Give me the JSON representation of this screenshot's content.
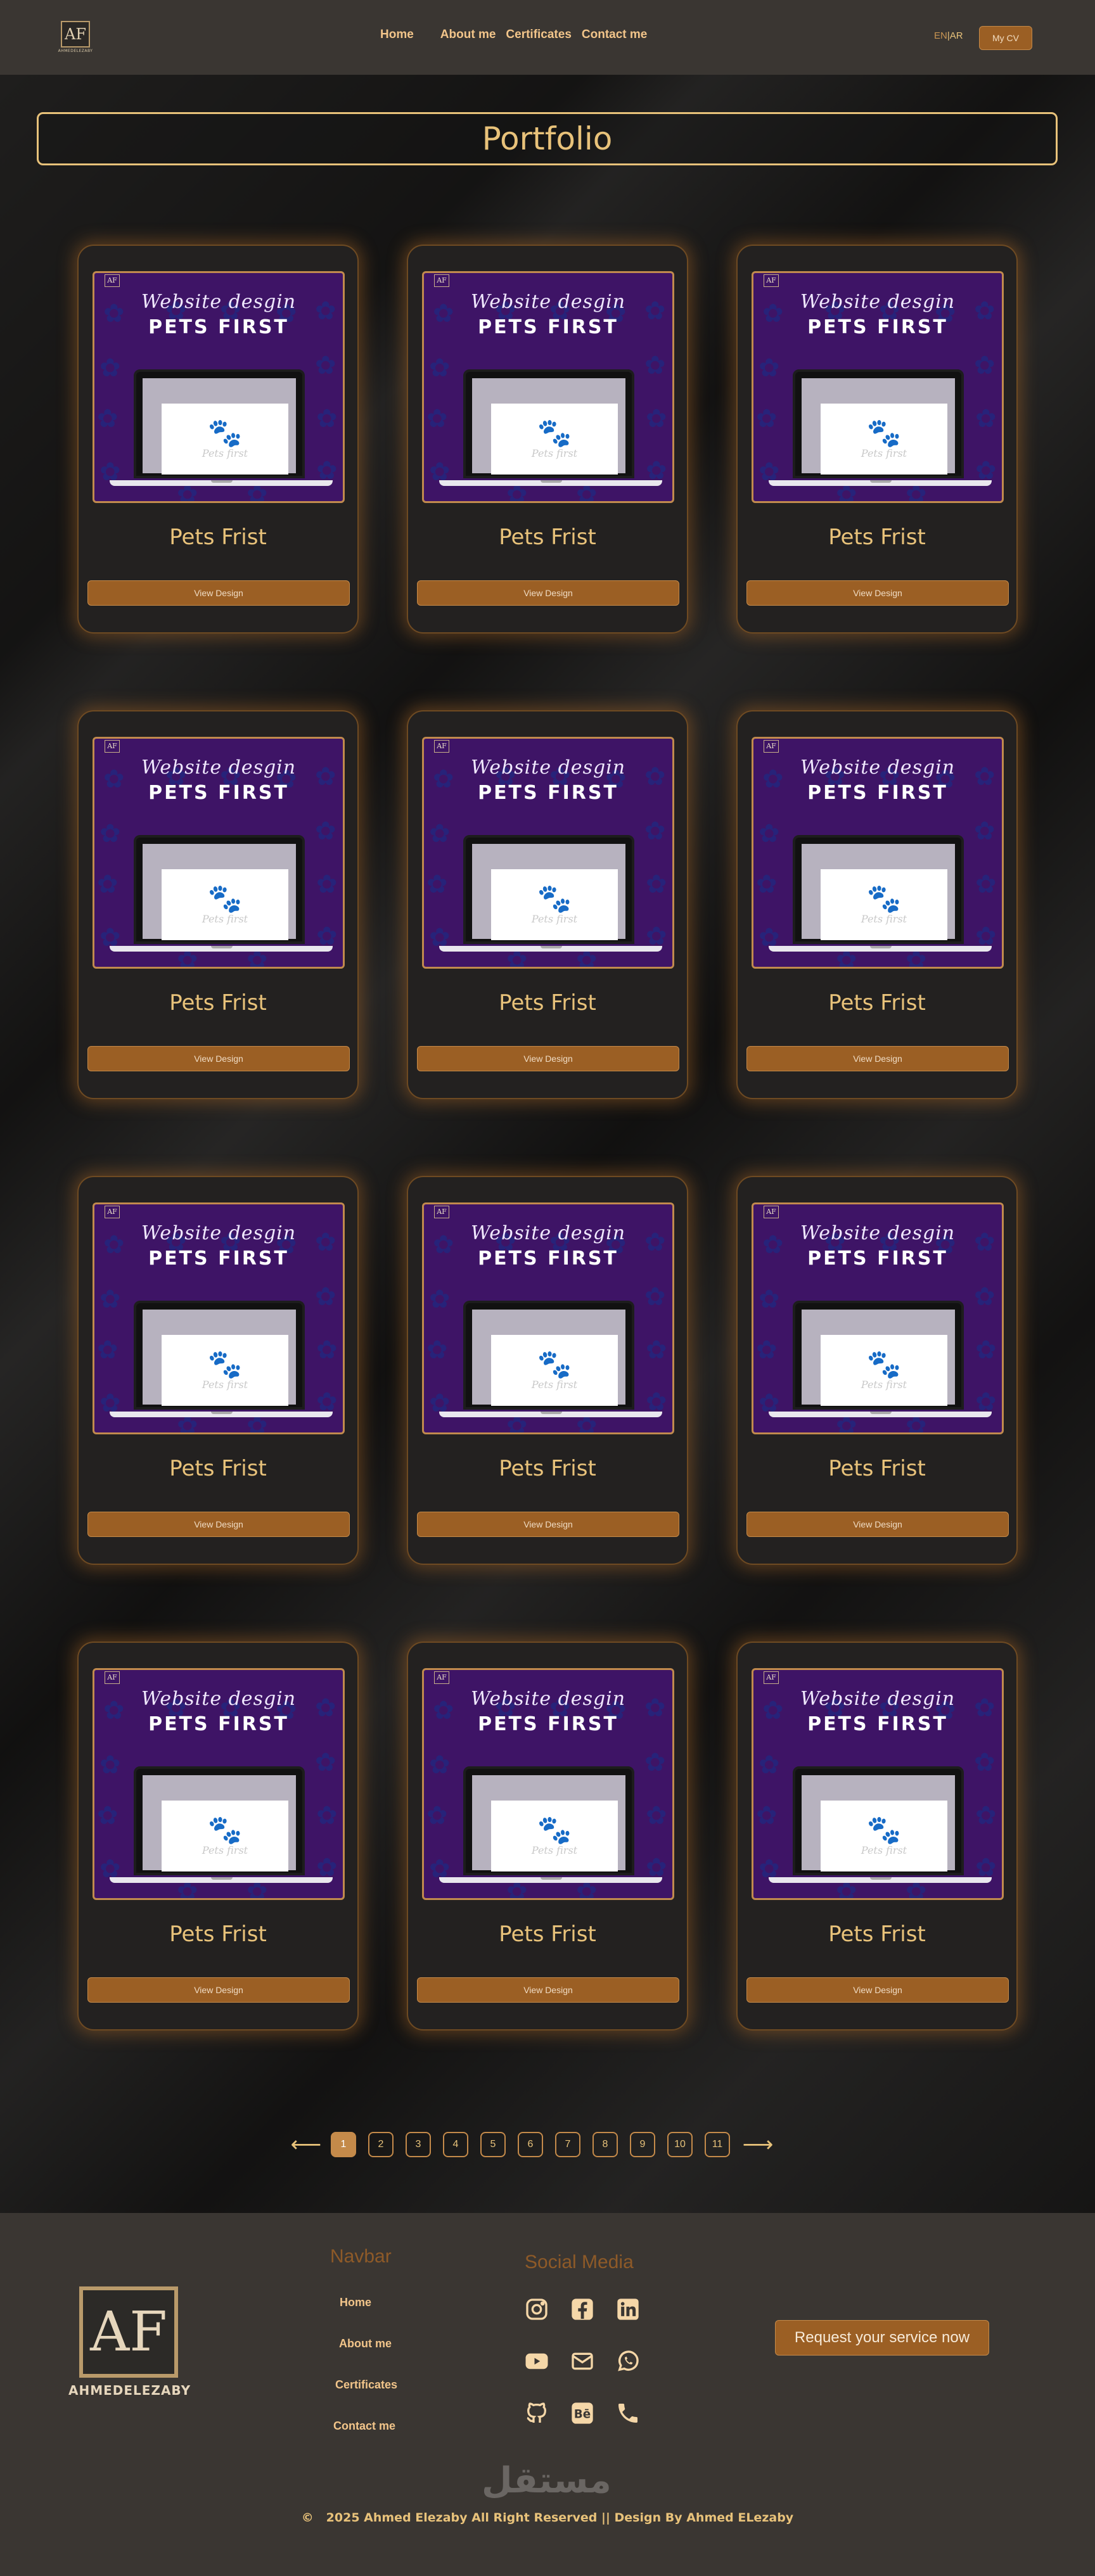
{
  "header": {
    "logo_caption": "AHMEDELEZABY",
    "logo_mark": "AF",
    "nav": [
      "Home",
      "About me",
      "Certificates",
      "Contact me"
    ],
    "lang_en": "EN",
    "lang_sep": "|",
    "lang_ar": "AR",
    "cv_label": "My CV"
  },
  "page_title": "Portfolio",
  "cards": [
    {
      "script": "Website desgin",
      "heading": "PETS FIRST",
      "screen_text": "Pets first",
      "title": "Pets Frist",
      "button": "View Design"
    },
    {
      "script": "Website desgin",
      "heading": "PETS FIRST",
      "screen_text": "Pets first",
      "title": "Pets Frist",
      "button": "View Design"
    },
    {
      "script": "Website desgin",
      "heading": "PETS FIRST",
      "screen_text": "Pets first",
      "title": "Pets Frist",
      "button": "View Design"
    },
    {
      "script": "Website desgin",
      "heading": "PETS FIRST",
      "screen_text": "Pets first",
      "title": "Pets Frist",
      "button": "View Design"
    },
    {
      "script": "Website desgin",
      "heading": "PETS FIRST",
      "screen_text": "Pets first",
      "title": "Pets Frist",
      "button": "View Design"
    },
    {
      "script": "Website desgin",
      "heading": "PETS FIRST",
      "screen_text": "Pets first",
      "title": "Pets Frist",
      "button": "View Design"
    },
    {
      "script": "Website desgin",
      "heading": "PETS FIRST",
      "screen_text": "Pets first",
      "title": "Pets Frist",
      "button": "View Design"
    },
    {
      "script": "Website desgin",
      "heading": "PETS FIRST",
      "screen_text": "Pets first",
      "title": "Pets Frist",
      "button": "View Design"
    },
    {
      "script": "Website desgin",
      "heading": "PETS FIRST",
      "screen_text": "Pets first",
      "title": "Pets Frist",
      "button": "View Design"
    },
    {
      "script": "Website desgin",
      "heading": "PETS FIRST",
      "screen_text": "Pets first",
      "title": "Pets Frist",
      "button": "View Design"
    },
    {
      "script": "Website desgin",
      "heading": "PETS FIRST",
      "screen_text": "Pets first",
      "title": "Pets Frist",
      "button": "View Design"
    },
    {
      "script": "Website desgin",
      "heading": "PETS FIRST",
      "screen_text": "Pets first",
      "title": "Pets Frist",
      "button": "View Design"
    }
  ],
  "pagination": {
    "prev_icon": "arrow-left-icon",
    "next_icon": "arrow-right-icon",
    "pages": [
      "1",
      "2",
      "3",
      "4",
      "5",
      "6",
      "7",
      "8",
      "9",
      "10",
      "11"
    ],
    "current": "1"
  },
  "footer": {
    "logo_caption": "AHMEDELEZABY",
    "logo_mark": "AF",
    "navbar_title": "Navbar",
    "navbar_links": [
      "Home",
      "About me",
      "Certificates",
      "Contact me"
    ],
    "social_title": "Social Media",
    "social_icons": [
      "instagram-icon",
      "facebook-icon",
      "linkedin-icon",
      "youtube-icon",
      "email-icon",
      "whatsapp-icon",
      "github-icon",
      "behance-icon",
      "phone-icon"
    ],
    "request_button": "Request your service now",
    "watermark": "مستقل",
    "copyright_symbol": "©",
    "copyright": "2025 Ahmed Elezaby All Right Reserved || Design By Ahmed ELezaby"
  },
  "colors": {
    "accent": "#e8c27a",
    "button": "#9b5f24",
    "card_border": "#6e4a22",
    "thumb_bg": "#3e1466"
  }
}
